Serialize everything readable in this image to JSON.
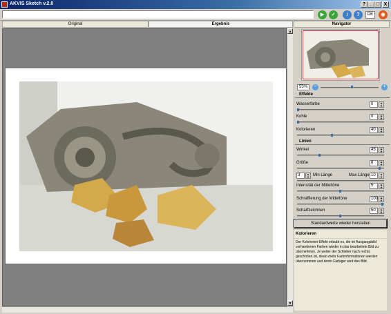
{
  "window": {
    "title": "AKVIS Sketch v.2.0",
    "controls": [
      "?",
      "_",
      "□",
      "X"
    ]
  },
  "toolbar": {
    "path_value": "",
    "icons": [
      "run-icon",
      "apply-icon",
      "info-icon",
      "help-icon",
      "language-icon",
      "akvis-icon"
    ],
    "language_label": "DE"
  },
  "tabs": [
    {
      "label": "Original",
      "active": false
    },
    {
      "label": "Ergebnis",
      "active": true
    }
  ],
  "navigator": {
    "title": "Navigator",
    "zoom": "55%",
    "zoom_level": 0.55
  },
  "effekte": {
    "title": "Effekte",
    "params": [
      {
        "label": "Wasserfarbe",
        "value": "0",
        "level": 0.0
      },
      {
        "label": "Kohle",
        "value": "0",
        "level": 0.0
      },
      {
        "label": "Kolorieren",
        "value": "40",
        "level": 0.4
      }
    ]
  },
  "linien": {
    "title": "Linien",
    "params": [
      {
        "label": "Winkel",
        "value": "45",
        "level": 0.25
      },
      {
        "label": "Größe",
        "value": "8",
        "level": 0.97
      },
      {
        "label": "Intensität der Mitteltöne",
        "value": "5",
        "level": 0.5
      },
      {
        "label": "Schraffierung der Mitteltöne",
        "value": "100",
        "level": 1.0
      },
      {
        "label": "Scharfzeichnen",
        "value": "50",
        "level": 0.5
      }
    ],
    "laenge": {
      "min_value": "3",
      "min_label": "Min Länge",
      "max_label": "Max Länge",
      "max_value": "10"
    }
  },
  "reset_button": "Standardwerte wieder herstellen",
  "help": {
    "title": "Kolorieren",
    "text": "Der Kolorieren-Effekt erlaubt es, die im Ausgangsbild vorhandenen Farben wieder in das bearbeitete Bild zu übernehmen. Je weiter der Schieber nach rechts geschoben ist, desto mehr Farbinformationen werden übernommen und desto Farbiger wird das Bild."
  },
  "colors": {
    "titlebar": "#0a246a",
    "panel": "#d4d0c8",
    "canvas_bg": "#808080",
    "accent": "#3a6ea5",
    "navigator_frame": "#dd2222"
  }
}
